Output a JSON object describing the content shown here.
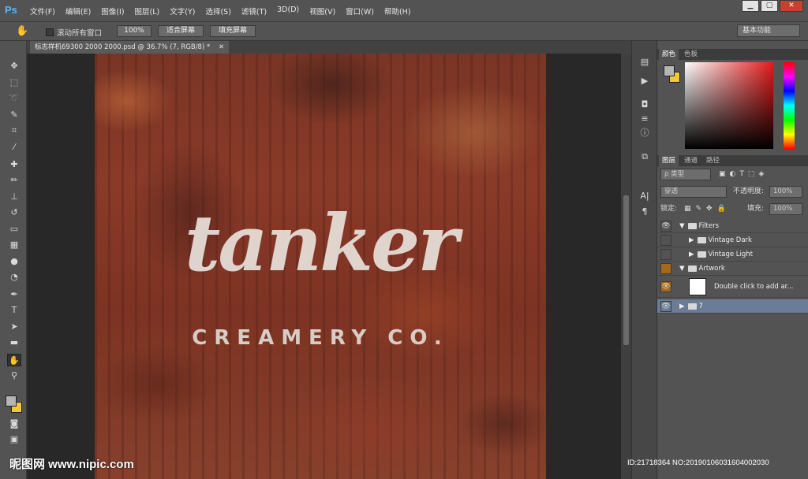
{
  "app": {
    "logo": "Ps"
  },
  "menu": [
    "文件(F)",
    "编辑(E)",
    "图像(I)",
    "图层(L)",
    "文字(Y)",
    "选择(S)",
    "滤镜(T)",
    "3D(D)",
    "视图(V)",
    "窗口(W)",
    "帮助(H)"
  ],
  "window_controls": {
    "minimize": "▁",
    "restore": "▢",
    "close": "✕"
  },
  "options": {
    "scroll_all_windows": "滚动所有窗口",
    "zoom_100": "100%",
    "fit_screen": "适合屏幕",
    "fill_screen": "填充屏幕",
    "workspace": "基本功能"
  },
  "document": {
    "tab_title": "标志样机69300 2000 2000.psd @ 36.7% (7, RGB/8) *",
    "tab_close": "✕"
  },
  "artwork": {
    "logo_text": "tanker",
    "sub_text": "CREAMERY CO."
  },
  "color_panel": {
    "tabs": [
      "颜色",
      "色板"
    ],
    "fg_color": "#b5b5b5",
    "bg_color": "#f0c935"
  },
  "layers_panel": {
    "tabs": [
      "图层",
      "通道",
      "路径"
    ],
    "filter_kind": "ρ 类型",
    "blend_mode": "穿透",
    "opacity_label": "不透明度:",
    "opacity_value": "100%",
    "lock_label": "锁定:",
    "fill_label": "填充:",
    "fill_value": "100%",
    "layers": [
      {
        "name": "Filters"
      },
      {
        "name": "Vintage Dark"
      },
      {
        "name": "Vintage Light"
      },
      {
        "name": "Artwork"
      },
      {
        "name": "Double click to add ar..."
      },
      {
        "name": "7"
      }
    ]
  },
  "watermark": {
    "site": "昵图网 www.nipic.com",
    "id_text": "ID:21718364 NO:20190106031604002030"
  }
}
